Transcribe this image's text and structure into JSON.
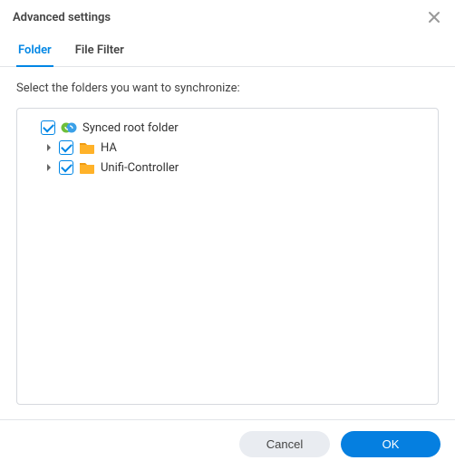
{
  "dialog": {
    "title": "Advanced settings"
  },
  "tabs": {
    "folder": "Folder",
    "file_filter": "File Filter"
  },
  "content": {
    "instruction": "Select the folders you want to synchronize:"
  },
  "tree": {
    "root": {
      "label": "Synced root folder",
      "checked": true
    },
    "children": [
      {
        "label": "HA",
        "checked": true
      },
      {
        "label": "Unifi-Controller",
        "checked": true
      }
    ]
  },
  "buttons": {
    "cancel": "Cancel",
    "ok": "OK"
  },
  "colors": {
    "accent": "#0086e5",
    "folder_fill": "#ffb229",
    "folder_tab": "#f09b12"
  }
}
